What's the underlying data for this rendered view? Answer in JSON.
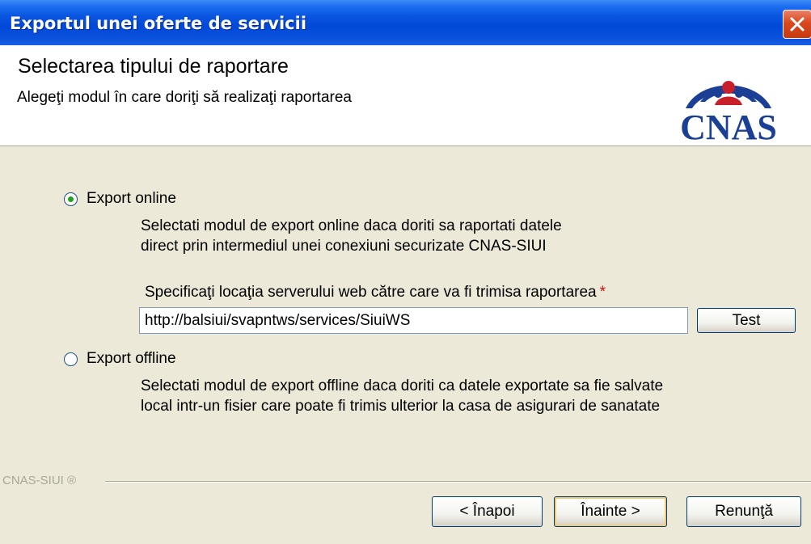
{
  "window": {
    "title": "Exportul unei oferte de servicii"
  },
  "header": {
    "title": "Selectarea tipului de raportare",
    "subtitle": "Alegeţi modul în care doriţi să realizaţi raportarea",
    "logo_text": "CNAS"
  },
  "options": {
    "online": {
      "label": "Export online",
      "checked": true,
      "description_line1": "Selectati modul de export online daca doriti sa raportati datele",
      "description_line2": "direct prin intermediul unei conexiuni securizate CNAS-SIUI"
    },
    "offline": {
      "label": "Export offline",
      "checked": false,
      "description_line1": "Selectati modul de export offline daca doriti ca datele exportate sa fie salvate",
      "description_line2": "local intr-un fisier care poate fi trimis ulterior la casa de asigurari de sanatate"
    }
  },
  "server": {
    "label": "Specificaţi locaţia serverului web către care va fi trimisa raportarea",
    "required_mark": "*",
    "url_value": "http://balsiui/svapntws/services/SiuiWS",
    "test_label": "Test"
  },
  "footer": {
    "brand": "CNAS-SIUI ®",
    "back_label": "< Înapoi",
    "next_label": "Înainte >",
    "cancel_label": "Renunţă"
  },
  "colors": {
    "titlebar": "#0a55e0",
    "dialog_bg": "#ece9d8",
    "logo_blue": "#1b3f94",
    "logo_red": "#c8202a",
    "radio_dot": "#21a121",
    "required": "#d01010"
  },
  "icons": {
    "close": "close-icon",
    "logo": "cnas-logo"
  }
}
